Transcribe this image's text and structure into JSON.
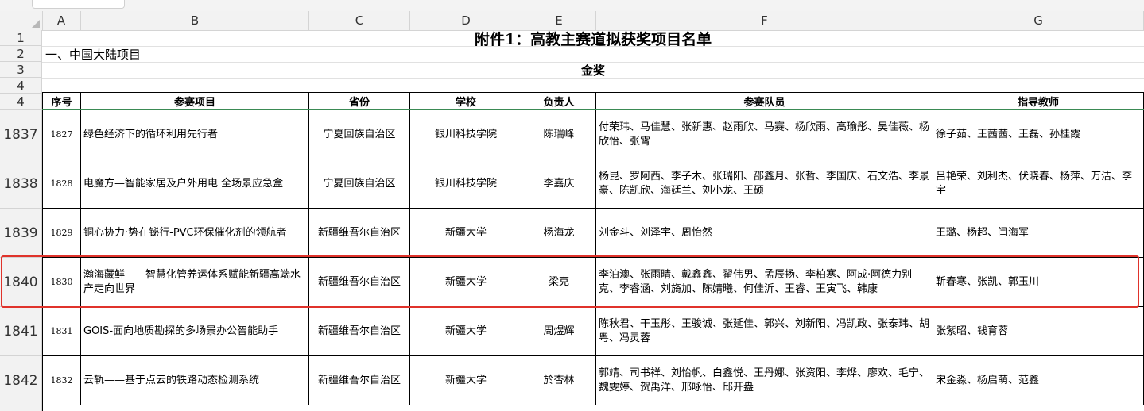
{
  "columns": [
    "A",
    "B",
    "C",
    "D",
    "E",
    "F",
    "G"
  ],
  "title": "附件1：高教主赛道拟获奖项目名单",
  "section": "一、中国大陆项目",
  "award": "金奖",
  "top_row_numbers": [
    "1",
    "2",
    "3",
    "4"
  ],
  "headers": {
    "no": "序号",
    "project": "参赛项目",
    "province": "省份",
    "school": "学校",
    "leader": "负责人",
    "members": "参赛队员",
    "teachers": "指导教师"
  },
  "rows": [
    {
      "rownum": "1837",
      "no": "1827",
      "project": "绿色经济下的循环利用先行者",
      "province": "宁夏回族自治区",
      "school": "银川科技学院",
      "leader": "陈瑞峰",
      "members": "付荣玮、马佳慧、张新惠、赵雨欣、马赛、杨欣雨、高瑜彤、吴佳薇、杨欣怡、张霄",
      "teachers": "徐子茹、王茜茜、王磊、孙桂霞"
    },
    {
      "rownum": "1838",
      "no": "1828",
      "project": "电魔方—智能家居及户外用电 全场景应急盒",
      "province": "宁夏回族自治区",
      "school": "银川科技学院",
      "leader": "李嘉庆",
      "members": "杨昆、罗阿西、李子木、张瑞阳、邵鑫月、张哲、李国庆、石文浩、李景豪、陈凯欣、海廷兰、刘小龙、王硕",
      "teachers": "吕艳荣、刘利杰、伏晓春、杨萍、万洁、李宇"
    },
    {
      "rownum": "1839",
      "no": "1829",
      "project": "铜心协力·势在铋行-PVC环保催化剂的领航者",
      "province": "新疆维吾尔自治区",
      "school": "新疆大学",
      "leader": "杨海龙",
      "members": "刘金斗、刘泽宇、周怡然",
      "teachers": "王璐、杨超、闫海军"
    },
    {
      "rownum": "1840",
      "no": "1830",
      "project": "瀚海藏鲜——智慧化管养运体系赋能新疆高端水产走向世界",
      "province": "新疆维吾尔自治区",
      "school": "新疆大学",
      "leader": "梁克",
      "members": "李泊澳、张雨晴、戴鑫鑫、翟伟男、孟辰扬、李柏寒、阿成·阿德力别克、李睿涵、刘旖加、陈婧曦、何佳沂、王睿、王寅飞、韩康",
      "teachers": "靳春寒、张凯、郭玉川"
    },
    {
      "rownum": "1841",
      "no": "1831",
      "project": "GOIS-面向地质勘探的多场景办公智能助手",
      "province": "新疆维吾尔自治区",
      "school": "新疆大学",
      "leader": "周煜辉",
      "members": "陈秋君、干玉彤、王骏诚、张延佳、郭兴、刘新阳、冯凯政、张泰玮、胡粤、冯灵蓉",
      "teachers": "张紫昭、钱育蓉"
    },
    {
      "rownum": "1842",
      "no": "1832",
      "project": "云轨——基于点云的铁路动态检测系统",
      "province": "新疆维吾尔自治区",
      "school": "新疆大学",
      "leader": "於杏林",
      "members": "郭靖、司书祥、刘怡帆、白鑫悦、王丹娜、张资阳、李烨、廖欢、毛宁、魏雯婷、贺禹洋、邢咏怡、邱开盎",
      "teachers": "宋金淼、杨启萌、范鑫"
    }
  ]
}
